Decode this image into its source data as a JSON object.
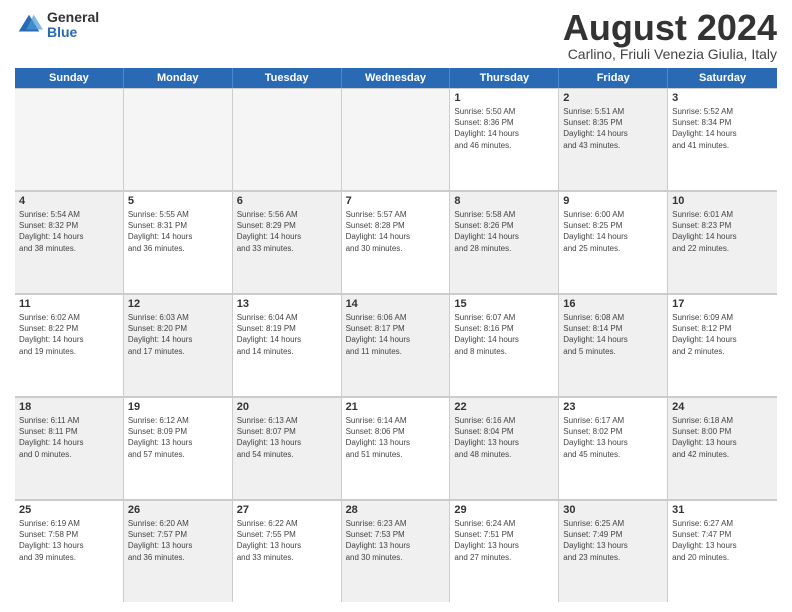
{
  "logo": {
    "general": "General",
    "blue": "Blue"
  },
  "title": "August 2024",
  "location": "Carlino, Friuli Venezia Giulia, Italy",
  "days_of_week": [
    "Sunday",
    "Monday",
    "Tuesday",
    "Wednesday",
    "Thursday",
    "Friday",
    "Saturday"
  ],
  "rows": [
    [
      {
        "day": "",
        "empty": true
      },
      {
        "day": "",
        "empty": true
      },
      {
        "day": "",
        "empty": true
      },
      {
        "day": "",
        "empty": true
      },
      {
        "day": "1",
        "info": "Sunrise: 5:50 AM\nSunset: 8:36 PM\nDaylight: 14 hours\nand 46 minutes."
      },
      {
        "day": "2",
        "info": "Sunrise: 5:51 AM\nSunset: 8:35 PM\nDaylight: 14 hours\nand 43 minutes.",
        "shaded": true
      },
      {
        "day": "3",
        "info": "Sunrise: 5:52 AM\nSunset: 8:34 PM\nDaylight: 14 hours\nand 41 minutes."
      }
    ],
    [
      {
        "day": "4",
        "info": "Sunrise: 5:54 AM\nSunset: 8:32 PM\nDaylight: 14 hours\nand 38 minutes.",
        "shaded": true
      },
      {
        "day": "5",
        "info": "Sunrise: 5:55 AM\nSunset: 8:31 PM\nDaylight: 14 hours\nand 36 minutes."
      },
      {
        "day": "6",
        "info": "Sunrise: 5:56 AM\nSunset: 8:29 PM\nDaylight: 14 hours\nand 33 minutes.",
        "shaded": true
      },
      {
        "day": "7",
        "info": "Sunrise: 5:57 AM\nSunset: 8:28 PM\nDaylight: 14 hours\nand 30 minutes."
      },
      {
        "day": "8",
        "info": "Sunrise: 5:58 AM\nSunset: 8:26 PM\nDaylight: 14 hours\nand 28 minutes.",
        "shaded": true
      },
      {
        "day": "9",
        "info": "Sunrise: 6:00 AM\nSunset: 8:25 PM\nDaylight: 14 hours\nand 25 minutes."
      },
      {
        "day": "10",
        "info": "Sunrise: 6:01 AM\nSunset: 8:23 PM\nDaylight: 14 hours\nand 22 minutes.",
        "shaded": true
      }
    ],
    [
      {
        "day": "11",
        "info": "Sunrise: 6:02 AM\nSunset: 8:22 PM\nDaylight: 14 hours\nand 19 minutes."
      },
      {
        "day": "12",
        "info": "Sunrise: 6:03 AM\nSunset: 8:20 PM\nDaylight: 14 hours\nand 17 minutes.",
        "shaded": true
      },
      {
        "day": "13",
        "info": "Sunrise: 6:04 AM\nSunset: 8:19 PM\nDaylight: 14 hours\nand 14 minutes."
      },
      {
        "day": "14",
        "info": "Sunrise: 6:06 AM\nSunset: 8:17 PM\nDaylight: 14 hours\nand 11 minutes.",
        "shaded": true
      },
      {
        "day": "15",
        "info": "Sunrise: 6:07 AM\nSunset: 8:16 PM\nDaylight: 14 hours\nand 8 minutes."
      },
      {
        "day": "16",
        "info": "Sunrise: 6:08 AM\nSunset: 8:14 PM\nDaylight: 14 hours\nand 5 minutes.",
        "shaded": true
      },
      {
        "day": "17",
        "info": "Sunrise: 6:09 AM\nSunset: 8:12 PM\nDaylight: 14 hours\nand 2 minutes."
      }
    ],
    [
      {
        "day": "18",
        "info": "Sunrise: 6:11 AM\nSunset: 8:11 PM\nDaylight: 14 hours\nand 0 minutes.",
        "shaded": true
      },
      {
        "day": "19",
        "info": "Sunrise: 6:12 AM\nSunset: 8:09 PM\nDaylight: 13 hours\nand 57 minutes."
      },
      {
        "day": "20",
        "info": "Sunrise: 6:13 AM\nSunset: 8:07 PM\nDaylight: 13 hours\nand 54 minutes.",
        "shaded": true
      },
      {
        "day": "21",
        "info": "Sunrise: 6:14 AM\nSunset: 8:06 PM\nDaylight: 13 hours\nand 51 minutes."
      },
      {
        "day": "22",
        "info": "Sunrise: 6:16 AM\nSunset: 8:04 PM\nDaylight: 13 hours\nand 48 minutes.",
        "shaded": true
      },
      {
        "day": "23",
        "info": "Sunrise: 6:17 AM\nSunset: 8:02 PM\nDaylight: 13 hours\nand 45 minutes."
      },
      {
        "day": "24",
        "info": "Sunrise: 6:18 AM\nSunset: 8:00 PM\nDaylight: 13 hours\nand 42 minutes.",
        "shaded": true
      }
    ],
    [
      {
        "day": "25",
        "info": "Sunrise: 6:19 AM\nSunset: 7:58 PM\nDaylight: 13 hours\nand 39 minutes."
      },
      {
        "day": "26",
        "info": "Sunrise: 6:20 AM\nSunset: 7:57 PM\nDaylight: 13 hours\nand 36 minutes.",
        "shaded": true
      },
      {
        "day": "27",
        "info": "Sunrise: 6:22 AM\nSunset: 7:55 PM\nDaylight: 13 hours\nand 33 minutes."
      },
      {
        "day": "28",
        "info": "Sunrise: 6:23 AM\nSunset: 7:53 PM\nDaylight: 13 hours\nand 30 minutes.",
        "shaded": true
      },
      {
        "day": "29",
        "info": "Sunrise: 6:24 AM\nSunset: 7:51 PM\nDaylight: 13 hours\nand 27 minutes."
      },
      {
        "day": "30",
        "info": "Sunrise: 6:25 AM\nSunset: 7:49 PM\nDaylight: 13 hours\nand 23 minutes.",
        "shaded": true
      },
      {
        "day": "31",
        "info": "Sunrise: 6:27 AM\nSunset: 7:47 PM\nDaylight: 13 hours\nand 20 minutes."
      }
    ]
  ]
}
